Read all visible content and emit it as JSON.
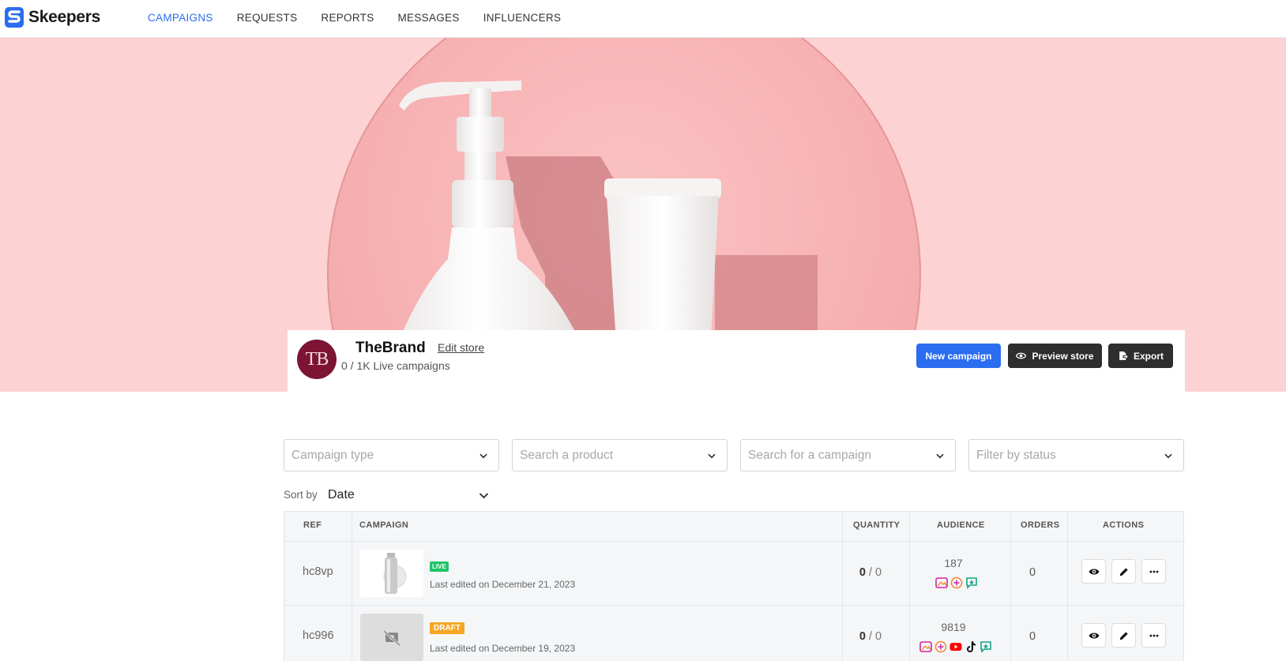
{
  "brand": {
    "name": "Skeepers"
  },
  "nav": {
    "items": [
      {
        "label": "CAMPAIGNS",
        "active": true
      },
      {
        "label": "REQUESTS",
        "active": false
      },
      {
        "label": "REPORTS",
        "active": false
      },
      {
        "label": "MESSAGES",
        "active": false
      },
      {
        "label": "INFLUENCERS",
        "active": false
      }
    ]
  },
  "store": {
    "initials": "TB",
    "name": "TheBrand",
    "edit_label": "Edit store",
    "subtitle": "0 / 1K Live campaigns",
    "buttons": {
      "new_campaign": "New campaign",
      "preview_store": "Preview store",
      "export": "Export"
    }
  },
  "filters": {
    "campaign_type": "Campaign type",
    "search_product": "Search a product",
    "search_campaign": "Search for a campaign",
    "filter_status": "Filter by status"
  },
  "sort": {
    "label": "Sort by",
    "value": "Date"
  },
  "table": {
    "headers": {
      "ref": "REF",
      "campaign": "CAMPAIGN",
      "quantity": "QUANTITY",
      "audience": "AUDIENCE",
      "orders": "ORDERS",
      "actions": "ACTIONS"
    },
    "rows": [
      {
        "ref": "hc8vp",
        "status": "LIVE",
        "edited": "Last edited on December 21, 2023",
        "qty_used": "0",
        "qty_sep": " / ",
        "qty_total": "0",
        "audience": "187",
        "orders": "0",
        "audience_icons": [
          "image-icon",
          "plus-circle-icon",
          "chat-star-icon"
        ]
      },
      {
        "ref": "hc996",
        "status": "DRAFT",
        "edited": "Last edited on December 19, 2023",
        "qty_used": "0",
        "qty_sep": " / ",
        "qty_total": "0",
        "audience": "9819",
        "orders": "0",
        "audience_icons": [
          "image-icon",
          "plus-circle-icon",
          "youtube-icon",
          "tiktok-icon",
          "chat-star-icon"
        ]
      }
    ]
  },
  "colors": {
    "accent": "#2b6df0",
    "hero_bg": "#fdd2d2",
    "avatar_bg": "#7d1433",
    "live": "#1fc46a",
    "draft": "#f5a623",
    "dark_button": "#2e2e2e"
  }
}
